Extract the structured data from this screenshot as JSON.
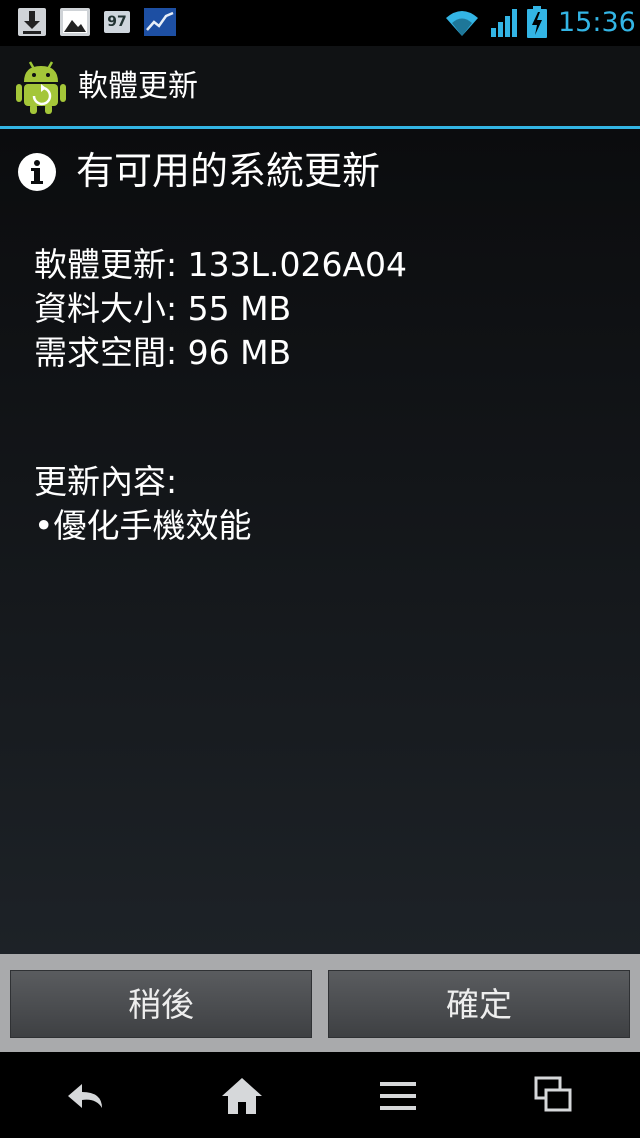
{
  "status_bar": {
    "time": "15:36",
    "notification_badge": "97",
    "icons": [
      "download-icon",
      "gallery-icon",
      "badge-icon",
      "stock-chart-icon",
      "wifi-icon",
      "signal-icon",
      "battery-charging-icon"
    ],
    "time_color": "#33b5e5"
  },
  "title_bar": {
    "title": "軟體更新",
    "icon": "android-update-icon",
    "divider_color": "#33b5e5"
  },
  "content": {
    "heading": "有可用的系統更新",
    "details": [
      "軟體更新: 133L.026A04",
      "資料大小: 55 MB",
      "需求空間: 96 MB"
    ],
    "notes": [
      "更新內容:",
      "•優化手機效能"
    ]
  },
  "buttons": {
    "later_label": "稍後",
    "ok_label": "確定"
  },
  "nav_bar": {
    "icons": [
      "back-icon",
      "home-icon",
      "menu-icon",
      "recent-apps-icon"
    ]
  }
}
